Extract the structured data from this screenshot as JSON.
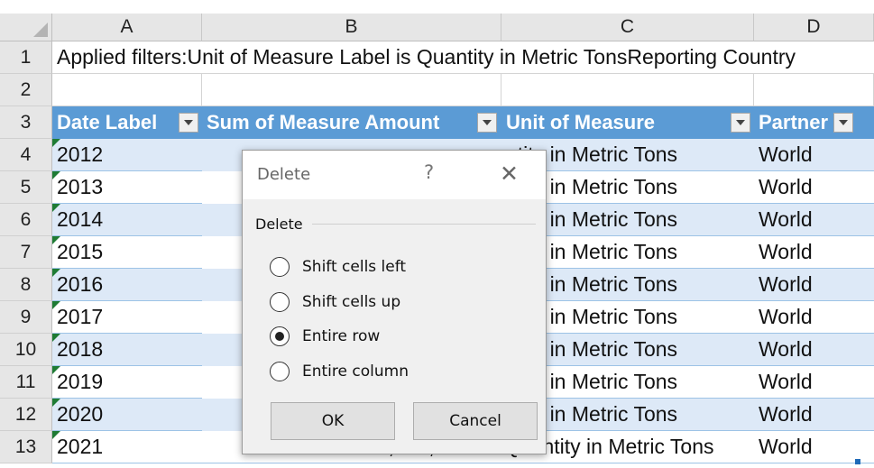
{
  "columns": [
    "A",
    "B",
    "C",
    "D"
  ],
  "rows": [
    "1",
    "2",
    "3",
    "4",
    "5",
    "6",
    "7",
    "8",
    "9",
    "10",
    "11",
    "12",
    "13"
  ],
  "row1_text": "Applied filters:Unit of Measure Label is Quantity in Metric TonsReporting Country",
  "header_row": {
    "date_label": "Date Label",
    "sum_label": "Sum of Measure Amount",
    "unit_label": "Unit of Measure",
    "partner_label": "Partner"
  },
  "data_rows": [
    {
      "year": "2012",
      "unit": "ntity in Metric Tons",
      "partner": "World"
    },
    {
      "year": "2013",
      "unit": "ntity in Metric Tons",
      "partner": "World"
    },
    {
      "year": "2014",
      "unit": "ntity in Metric Tons",
      "partner": "World"
    },
    {
      "year": "2015",
      "unit": "ntity in Metric Tons",
      "partner": "World"
    },
    {
      "year": "2016",
      "unit": "ntity in Metric Tons",
      "partner": "World"
    },
    {
      "year": "2017",
      "unit": "ntity in Metric Tons",
      "partner": "World"
    },
    {
      "year": "2018",
      "unit": "ntity in Metric Tons",
      "partner": "World"
    },
    {
      "year": "2019",
      "unit": "ntity in Metric Tons",
      "partner": "World"
    },
    {
      "year": "2020",
      "unit": "ntity in Metric Tons",
      "partner": "World"
    },
    {
      "year": "2021",
      "unit": "Quantity in Metric Tons",
      "partner": "World",
      "sum_partial": "5,346,867.76"
    }
  ],
  "dialog": {
    "title": "Delete",
    "help": "?",
    "close": "✕",
    "group_label": "Delete",
    "options": [
      "Shift cells left",
      "Shift cells up",
      "Entire row",
      "Entire column"
    ],
    "selected_option": "Entire row",
    "ok_label": "OK",
    "cancel_label": "Cancel"
  },
  "colors": {
    "header_fill": "#5b9bd5",
    "band_fill": "#dde9f7",
    "error_indicator": "#1e7b34"
  }
}
